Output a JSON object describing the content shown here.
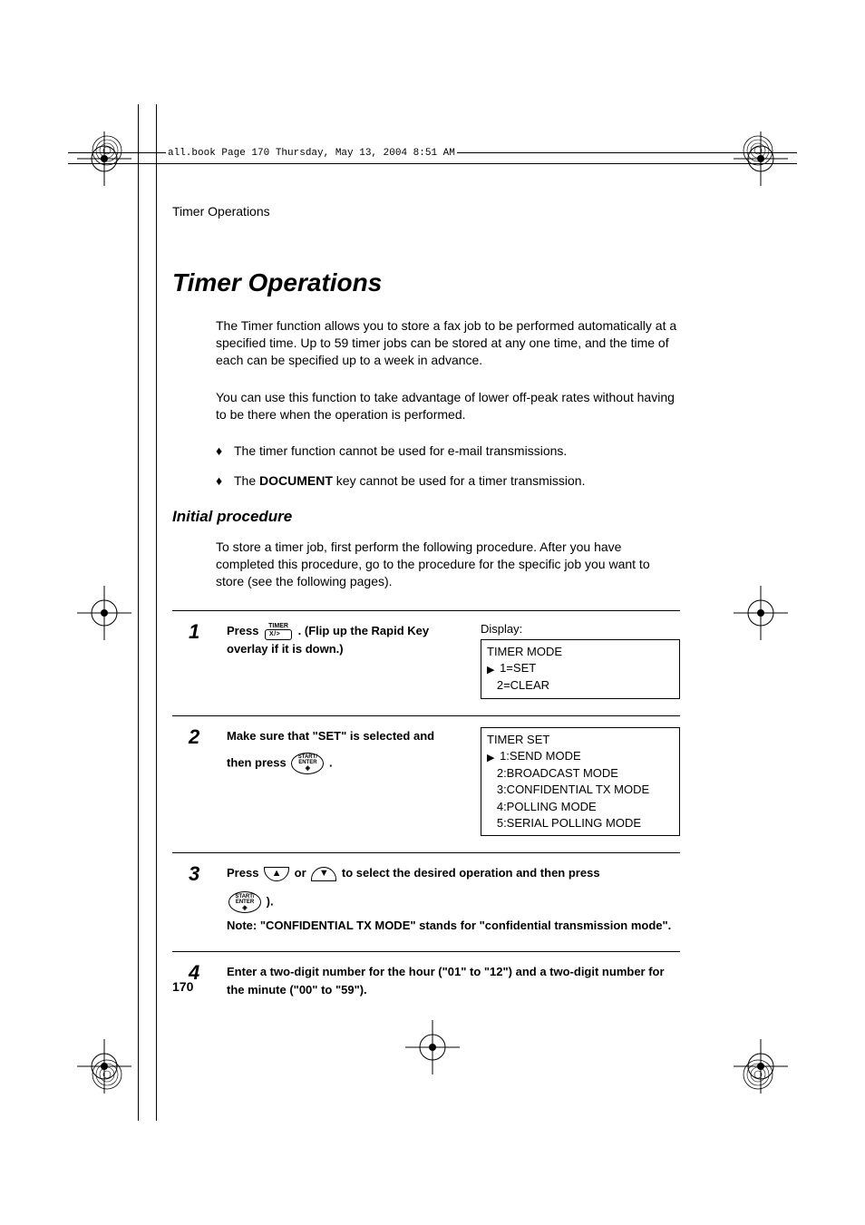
{
  "meta": {
    "book_line": "all.book  Page 170  Thursday, May 13, 2004  8:51 AM"
  },
  "header": {
    "running": "Timer Operations"
  },
  "title": "Timer Operations",
  "intro": {
    "p1": "The Timer function allows you to store a fax job to be performed automatically at a specified time. Up to 59 timer jobs can be stored at any one time, and the time of each can be specified up to a week in advance.",
    "p2": "You can use this function to take advantage of lower off-peak rates without having to be there when the operation is performed."
  },
  "bullets": {
    "b1": "The timer function cannot be used for e-mail transmissions.",
    "b2_pre": "The ",
    "b2_key": "DOCUMENT",
    "b2_post": " key cannot be used for a timer transmission."
  },
  "section2": {
    "head": "Initial procedure",
    "intro": "To store a timer job, first perform the following procedure. After you have completed this procedure, go to the procedure for the specific job you want to store (see the following pages)."
  },
  "steps": {
    "display_label": "Display:",
    "s1": {
      "num": "1",
      "pre": "Press ",
      "key_label": "TIMER",
      "key_box": "X/>",
      "post": " . (Flip up the Rapid Key overlay if it is down.)",
      "lcd": {
        "l1": "TIMER MODE",
        "l2_marker": "▶",
        "l2": " 1=SET",
        "l3": "   2=CLEAR"
      }
    },
    "s2": {
      "num": "2",
      "line1": "Make sure that \"SET\" is selected and",
      "line2_pre": "then press ",
      "enter_top": "START/",
      "enter_bot": "ENTER",
      "line2_post": ".",
      "lcd": {
        "l1": "TIMER SET",
        "l2_marker": "▶",
        "l2": " 1:SEND MODE",
        "l3": "   2:BROADCAST MODE",
        "l4": "   3:CONFIDENTIAL TX MODE",
        "l5": "   4:POLLING MODE",
        "l6": "   5:SERIAL POLLING MODE"
      }
    },
    "s3": {
      "num": "3",
      "pre": "Press ",
      "mid": " or ",
      "post": " to select the desired operation and then press",
      "line2_post": ").",
      "note": "Note: \"CONFIDENTIAL TX MODE\" stands for \"confidential transmission mode\"."
    },
    "s4": {
      "num": "4",
      "text": "Enter a two-digit number for the hour (\"01\" to \"12\") and a two-digit number for the minute (\"00\" to \"59\")."
    }
  },
  "footer": {
    "page": "170"
  }
}
